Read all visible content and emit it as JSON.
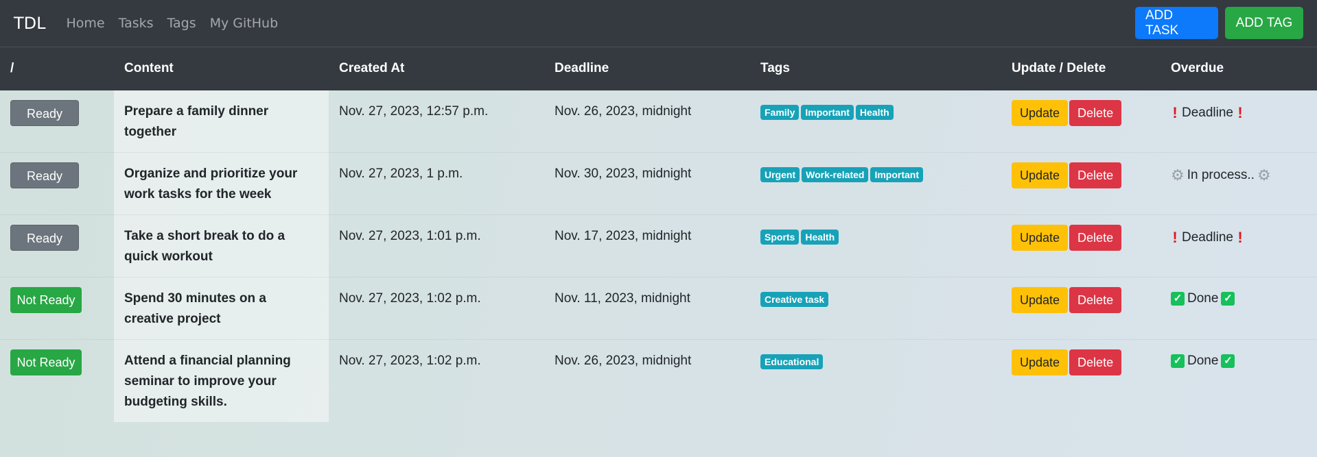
{
  "navbar": {
    "brand": "TDL",
    "links": [
      "Home",
      "Tasks",
      "Tags",
      "My GitHub"
    ],
    "add_task": "ADD TASK",
    "add_tag": "ADD TAG",
    "colors": {
      "add_task": "#0d79fb",
      "add_tag": "#28a745",
      "bg": "#343a40"
    }
  },
  "table": {
    "headers": [
      "/",
      "Content",
      "Created At",
      "Deadline",
      "Tags",
      "Update / Delete",
      "Overdue"
    ],
    "update_label": "Update",
    "delete_label": "Delete",
    "rows": [
      {
        "status": "Ready",
        "content": "Prepare a family dinner together",
        "created": "Nov. 27, 2023, 12:57 p.m.",
        "deadline": "Nov. 26, 2023, midnight",
        "tags": [
          "Family",
          "Important",
          "Health"
        ],
        "overdue": "Deadline",
        "overdue_icon": "exclamation-icon"
      },
      {
        "status": "Ready",
        "content": "Organize and prioritize your work tasks for the week",
        "created": "Nov. 27, 2023, 1 p.m.",
        "deadline": "Nov. 30, 2023, midnight",
        "tags": [
          "Urgent",
          "Work-related",
          "Important"
        ],
        "overdue": "In process..",
        "overdue_icon": "gear-icon"
      },
      {
        "status": "Ready",
        "content": "Take a short break to do a quick workout",
        "created": "Nov. 27, 2023, 1:01 p.m.",
        "deadline": "Nov. 17, 2023, midnight",
        "tags": [
          "Sports",
          "Health"
        ],
        "overdue": "Deadline",
        "overdue_icon": "exclamation-icon"
      },
      {
        "status": "Not Ready",
        "content": "Spend 30 minutes on a creative project",
        "created": "Nov. 27, 2023, 1:02 p.m.",
        "deadline": "Nov. 11, 2023, midnight",
        "tags": [
          "Creative task"
        ],
        "overdue": "Done",
        "overdue_icon": "check-icon"
      },
      {
        "status": "Not Ready",
        "content": "Attend a financial planning seminar to improve your budgeting skills.",
        "created": "Nov. 27, 2023, 1:02 p.m.",
        "deadline": "Nov. 26, 2023, midnight",
        "tags": [
          "Educational"
        ],
        "overdue": "Done",
        "overdue_icon": "check-icon"
      }
    ]
  }
}
